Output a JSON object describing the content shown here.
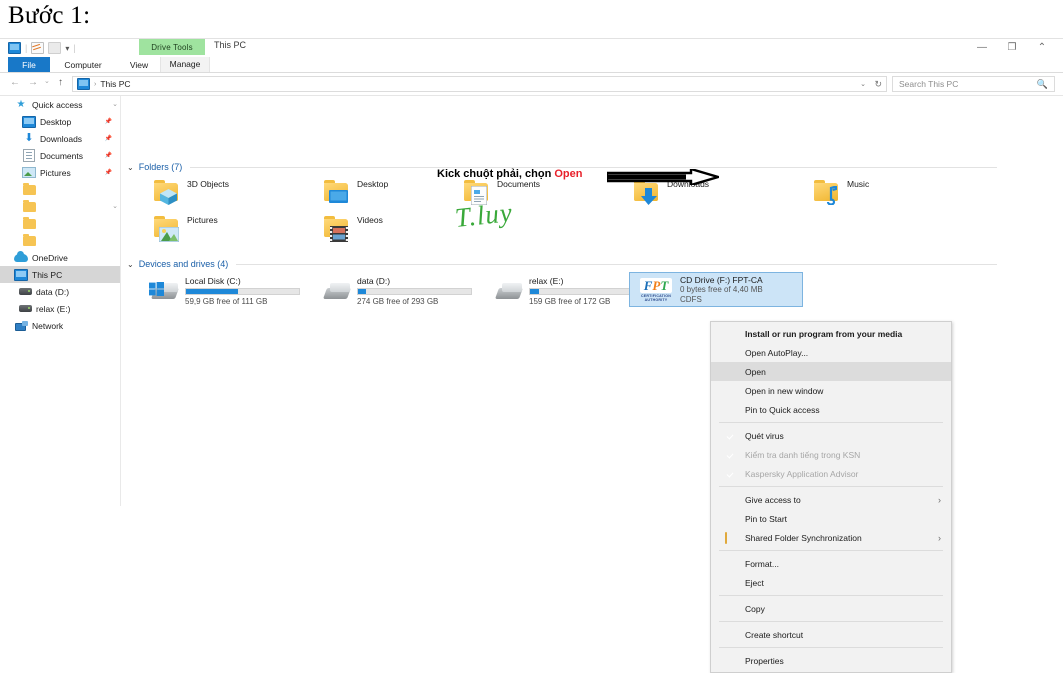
{
  "doc": {
    "heading": "Bước 1:"
  },
  "window": {
    "title": "This PC",
    "contextual_tab": "Drive Tools",
    "quick_access_icons": [
      "pc-icon",
      "chart-icon",
      "folder-icon",
      "dropdown-caret"
    ],
    "controls": {
      "minimize": "—",
      "maximize": "❐",
      "close": "⌃",
      "collapse_ribbon": "⌄"
    },
    "tabs": [
      {
        "label": "File",
        "active": true
      },
      {
        "label": "Computer",
        "active": false
      },
      {
        "label": "View",
        "active": false
      },
      {
        "label": "Manage",
        "active": false
      }
    ]
  },
  "addressbar": {
    "back": "←",
    "forward": "→",
    "recent": "⌄",
    "up": "↑",
    "breadcrumb_root": "This PC",
    "breadcrumb_sep": "›",
    "dropdown_caret": "⌄",
    "refresh": "↻"
  },
  "search": {
    "placeholder": "Search This PC",
    "icon": "search-icon"
  },
  "sidebar": {
    "items": [
      {
        "label": "Quick access",
        "icon": "star-icon",
        "pinned": false,
        "selected": false,
        "indent": 14,
        "chevron": true
      },
      {
        "label": "Desktop",
        "icon": "desktop-icon",
        "pinned": true,
        "selected": false,
        "indent": 22
      },
      {
        "label": "Downloads",
        "icon": "download-icon",
        "pinned": true,
        "selected": false,
        "indent": 22
      },
      {
        "label": "Documents",
        "icon": "document-icon",
        "pinned": true,
        "selected": false,
        "indent": 22
      },
      {
        "label": "Pictures",
        "icon": "picture-icon",
        "pinned": true,
        "selected": false,
        "indent": 22
      },
      {
        "label": "",
        "icon": "folder-icon",
        "pinned": false,
        "selected": false,
        "indent": 22
      },
      {
        "label": "",
        "icon": "folder-icon",
        "pinned": false,
        "selected": false,
        "indent": 22,
        "chevron": true
      },
      {
        "label": "",
        "icon": "folder-icon",
        "pinned": false,
        "selected": false,
        "indent": 22
      },
      {
        "label": "",
        "icon": "folder-icon",
        "pinned": false,
        "selected": false,
        "indent": 22
      },
      {
        "label": "OneDrive",
        "icon": "cloud-icon",
        "pinned": false,
        "selected": false,
        "indent": 14
      },
      {
        "label": "This PC",
        "icon": "pc-icon",
        "pinned": false,
        "selected": true,
        "indent": 14
      },
      {
        "label": "data (D:)",
        "icon": "disk-icon",
        "pinned": false,
        "selected": false,
        "indent": 18
      },
      {
        "label": "relax (E:)",
        "icon": "disk-icon",
        "pinned": false,
        "selected": false,
        "indent": 18
      },
      {
        "label": "Network",
        "icon": "network-icon",
        "pinned": false,
        "selected": false,
        "indent": 14
      }
    ]
  },
  "content": {
    "groups": [
      {
        "title": "Folders (7)",
        "chevron": "⌄"
      },
      {
        "title": "Devices and drives (4)",
        "chevron": "⌄"
      }
    ],
    "folders": [
      {
        "name": "3D Objects",
        "icon": "folder-3d-objects-icon"
      },
      {
        "name": "Desktop",
        "icon": "folder-desktop-icon"
      },
      {
        "name": "Documents",
        "icon": "folder-documents-icon"
      },
      {
        "name": "Downloads",
        "icon": "folder-downloads-icon"
      },
      {
        "name": "Music",
        "icon": "folder-music-icon"
      },
      {
        "name": "Pictures",
        "icon": "folder-pictures-icon"
      },
      {
        "name": "Videos",
        "icon": "folder-videos-icon"
      }
    ],
    "drives": [
      {
        "name": "Local Disk (C:)",
        "free_text": "59,9 GB free of 111 GB",
        "used_percent": 46,
        "icon": "windows-drive-icon"
      },
      {
        "name": "data (D:)",
        "free_text": "274 GB free of 293 GB",
        "used_percent": 7,
        "icon": "drive-icon"
      },
      {
        "name": "relax (E:)",
        "free_text": "159 GB free of 172 GB",
        "used_percent": 8,
        "icon": "drive-icon"
      }
    ],
    "cd_drive": {
      "name": "CD Drive (F:) FPT-CA",
      "free_text": "0 bytes free of 4,40 MB",
      "filesystem": "CDFS",
      "icon": "fpt-certification-authority-icon",
      "logo_text": "FPT",
      "logo_sub": "CERTIFICATION AUTHORITY",
      "selected": true
    }
  },
  "context_menu": {
    "items": [
      {
        "label": "Install or run program from your media",
        "bold": true
      },
      {
        "label": "Open AutoPlay..."
      },
      {
        "label": "Open",
        "highlighted": true
      },
      {
        "label": "Open in new window"
      },
      {
        "label": "Pin to Quick access"
      },
      {
        "separator": true
      },
      {
        "label": "Quét virus",
        "icon": "kaspersky-shield-icon"
      },
      {
        "label": "Kiểm tra danh tiếng trong KSN",
        "icon": "kaspersky-shield-icon",
        "disabled": true
      },
      {
        "label": "Kaspersky Application Advisor",
        "icon": "kaspersky-shield-icon",
        "disabled": true
      },
      {
        "separator": true
      },
      {
        "label": "Give access to",
        "submenu": "›"
      },
      {
        "label": "Pin to Start"
      },
      {
        "label": "Shared Folder Synchronization",
        "icon": "shared-folder-sync-icon",
        "submenu": "›"
      },
      {
        "separator": true
      },
      {
        "label": "Format..."
      },
      {
        "label": "Eject"
      },
      {
        "separator": true
      },
      {
        "label": "Copy"
      },
      {
        "separator": true
      },
      {
        "label": "Create shortcut"
      },
      {
        "separator": true
      },
      {
        "label": "Properties"
      }
    ]
  },
  "annotation": {
    "text_before": "Kick chuột phải, chọn ",
    "highlight": "Open",
    "highlight_color": "#e8202a",
    "arrow": "arrow-right-pointer",
    "signature": "T.luy",
    "signature_color": "#3aa93a"
  }
}
